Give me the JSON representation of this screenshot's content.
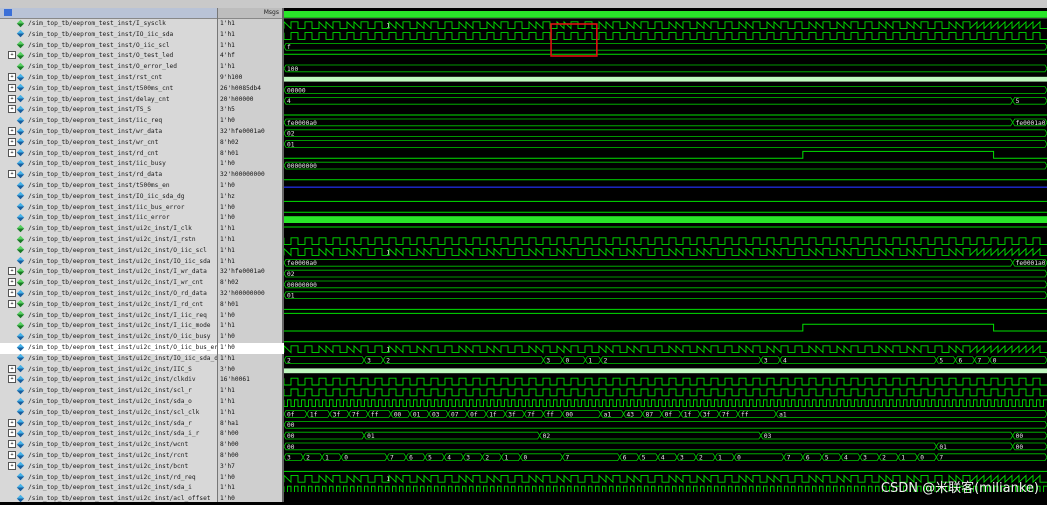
{
  "header": {
    "msgs_label": "Msgs"
  },
  "watermark": "CSDN @米联客(milianke)",
  "signals": [
    {
      "name": "/sim_top_tb/eeprom_test_inst/I_sysclk",
      "value": "1'h1",
      "exp": false,
      "in": true,
      "kind": "clk"
    },
    {
      "name": "/sim_top_tb/eeprom_test_inst/IO_iic_sda",
      "value": "1'h1",
      "exp": false,
      "in": false,
      "kind": "sda",
      "labels": [
        {
          "t": 0.13,
          "text": "1"
        }
      ]
    },
    {
      "name": "/sim_top_tb/eeprom_test_inst/O_iic_scl",
      "value": "1'h1",
      "exp": false,
      "in": true,
      "kind": "scl"
    },
    {
      "name": "/sim_top_tb/eeprom_test_inst/O_test_led",
      "value": "4'hf",
      "exp": true,
      "in": true,
      "kind": "bus",
      "labels": [
        {
          "t": 0.0,
          "text": "f"
        }
      ]
    },
    {
      "name": "/sim_top_tb/eeprom_test_inst/O_error_led",
      "value": "1'h1",
      "exp": false,
      "in": true,
      "kind": "high"
    },
    {
      "name": "/sim_top_tb/eeprom_test_inst/rst_cnt",
      "value": "9'h100",
      "exp": true,
      "in": false,
      "kind": "bus",
      "labels": [
        {
          "t": 0.0,
          "text": "100"
        }
      ]
    },
    {
      "name": "/sim_top_tb/eeprom_test_inst/t500ms_cnt",
      "value": "26'h0085db4",
      "exp": true,
      "in": false,
      "kind": "busdense"
    },
    {
      "name": "/sim_top_tb/eeprom_test_inst/delay_cnt",
      "value": "20'h00000",
      "exp": true,
      "in": false,
      "kind": "bus",
      "labels": [
        {
          "t": 0.0,
          "text": "00000"
        }
      ]
    },
    {
      "name": "/sim_top_tb/eeprom_test_inst/TS_S",
      "value": "3'h5",
      "exp": true,
      "in": false,
      "kind": "bus",
      "labels": [
        {
          "t": 0.0,
          "text": "4"
        },
        {
          "t": 0.955,
          "text": "5"
        }
      ]
    },
    {
      "name": "/sim_top_tb/eeprom_test_inst/iic_req",
      "value": "1'h0",
      "exp": false,
      "in": false,
      "kind": "low"
    },
    {
      "name": "/sim_top_tb/eeprom_test_inst/wr_data",
      "value": "32'hfe0001a0",
      "exp": true,
      "in": false,
      "kind": "bus",
      "labels": [
        {
          "t": 0.0,
          "text": "fe0000a0"
        },
        {
          "t": 0.955,
          "text": "fe0001a0"
        }
      ]
    },
    {
      "name": "/sim_top_tb/eeprom_test_inst/wr_cnt",
      "value": "8'h02",
      "exp": true,
      "in": false,
      "kind": "bus",
      "labels": [
        {
          "t": 0.0,
          "text": "02"
        }
      ]
    },
    {
      "name": "/sim_top_tb/eeprom_test_inst/rd_cnt",
      "value": "8'h01",
      "exp": true,
      "in": false,
      "kind": "bus",
      "labels": [
        {
          "t": 0.0,
          "text": "01"
        }
      ]
    },
    {
      "name": "/sim_top_tb/eeprom_test_inst/iic_busy",
      "value": "1'h0",
      "exp": false,
      "in": false,
      "kind": "busyend"
    },
    {
      "name": "/sim_top_tb/eeprom_test_inst/rd_data",
      "value": "32'h00000000",
      "exp": true,
      "in": false,
      "kind": "bus",
      "labels": [
        {
          "t": 0.0,
          "text": "00000000"
        }
      ]
    },
    {
      "name": "/sim_top_tb/eeprom_test_inst/t500ms_en",
      "value": "1'h0",
      "exp": false,
      "in": false,
      "kind": "low"
    },
    {
      "name": "/sim_top_tb/eeprom_test_inst/IO_iic_sda_dg",
      "value": "1'hz",
      "exp": false,
      "in": false,
      "kind": "hiz"
    },
    {
      "name": "/sim_top_tb/eeprom_test_inst/iic_bus_error",
      "value": "1'h0",
      "exp": false,
      "in": false,
      "kind": "low"
    },
    {
      "name": "/sim_top_tb/eeprom_test_inst/iic_error",
      "value": "1'h0",
      "exp": false,
      "in": false,
      "kind": "low"
    },
    {
      "name": "/sim_top_tb/eeprom_test_inst/ui2c_inst/I_clk",
      "value": "1'h1",
      "exp": false,
      "in": true,
      "kind": "clk"
    },
    {
      "name": "/sim_top_tb/eeprom_test_inst/ui2c_inst/I_rstn",
      "value": "1'h1",
      "exp": false,
      "in": true,
      "kind": "high"
    },
    {
      "name": "/sim_top_tb/eeprom_test_inst/ui2c_inst/O_iic_scl",
      "value": "1'h1",
      "exp": false,
      "in": true,
      "kind": "scl"
    },
    {
      "name": "/sim_top_tb/eeprom_test_inst/ui2c_inst/IO_iic_sda",
      "value": "1'h1",
      "exp": false,
      "in": false,
      "kind": "sda",
      "labels": [
        {
          "t": 0.13,
          "text": "1"
        }
      ]
    },
    {
      "name": "/sim_top_tb/eeprom_test_inst/ui2c_inst/I_wr_data",
      "value": "32'hfe0001a0",
      "exp": true,
      "in": true,
      "kind": "bus",
      "labels": [
        {
          "t": 0.0,
          "text": "fe0000a0"
        },
        {
          "t": 0.955,
          "text": "fe0001a0"
        }
      ]
    },
    {
      "name": "/sim_top_tb/eeprom_test_inst/ui2c_inst/I_wr_cnt",
      "value": "8'h02",
      "exp": true,
      "in": true,
      "kind": "bus",
      "labels": [
        {
          "t": 0.0,
          "text": "02"
        }
      ]
    },
    {
      "name": "/sim_top_tb/eeprom_test_inst/ui2c_inst/O_rd_data",
      "value": "32'h00000000",
      "exp": true,
      "in": false,
      "kind": "bus",
      "labels": [
        {
          "t": 0.0,
          "text": "00000000"
        }
      ]
    },
    {
      "name": "/sim_top_tb/eeprom_test_inst/ui2c_inst/I_rd_cnt",
      "value": "8'h01",
      "exp": true,
      "in": true,
      "kind": "bus",
      "labels": [
        {
          "t": 0.0,
          "text": "01"
        }
      ]
    },
    {
      "name": "/sim_top_tb/eeprom_test_inst/ui2c_inst/I_iic_req",
      "value": "1'h0",
      "exp": false,
      "in": true,
      "kind": "low"
    },
    {
      "name": "/sim_top_tb/eeprom_test_inst/ui2c_inst/I_iic_mode",
      "value": "1'h1",
      "exp": false,
      "in": true,
      "kind": "high"
    },
    {
      "name": "/sim_top_tb/eeprom_test_inst/ui2c_inst/O_iic_busy",
      "value": "1'h0",
      "exp": false,
      "in": false,
      "kind": "busyend"
    },
    {
      "name": "/sim_top_tb/eeprom_test_inst/ui2c_inst/O_iic_bus_error",
      "value": "1'h0",
      "exp": false,
      "in": false,
      "kind": "low",
      "selected": true
    },
    {
      "name": "/sim_top_tb/eeprom_test_inst/ui2c_inst/IO_iic_sda_dg",
      "value": "1'h1",
      "exp": false,
      "in": false,
      "kind": "sdadg",
      "labels": [
        {
          "t": 0.13,
          "text": "1"
        }
      ]
    },
    {
      "name": "/sim_top_tb/eeprom_test_inst/ui2c_inst/IIC_S",
      "value": "3'h0",
      "exp": true,
      "in": false,
      "kind": "bus",
      "labels": [
        {
          "t": 0.0,
          "text": "2"
        },
        {
          "t": 0.105,
          "text": "3"
        },
        {
          "t": 0.13,
          "text": "2"
        },
        {
          "t": 0.34,
          "text": "3"
        },
        {
          "t": 0.365,
          "text": "0"
        },
        {
          "t": 0.395,
          "text": "1"
        },
        {
          "t": 0.415,
          "text": "2"
        },
        {
          "t": 0.625,
          "text": "3"
        },
        {
          "t": 0.65,
          "text": "4"
        },
        {
          "t": 0.855,
          "text": "5"
        },
        {
          "t": 0.88,
          "text": "6"
        },
        {
          "t": 0.905,
          "text": "7"
        },
        {
          "t": 0.925,
          "text": "0"
        }
      ]
    },
    {
      "name": "/sim_top_tb/eeprom_test_inst/ui2c_inst/clkdiv",
      "value": "16'h0061",
      "exp": true,
      "in": false,
      "kind": "busdense"
    },
    {
      "name": "/sim_top_tb/eeprom_test_inst/ui2c_inst/scl_r",
      "value": "1'h1",
      "exp": false,
      "in": false,
      "kind": "scl"
    },
    {
      "name": "/sim_top_tb/eeprom_test_inst/ui2c_inst/sda_o",
      "value": "1'h1",
      "exp": false,
      "in": false,
      "kind": "scl"
    },
    {
      "name": "/sim_top_tb/eeprom_test_inst/ui2c_inst/scl_clk",
      "value": "1'h1",
      "exp": false,
      "in": false,
      "kind": "clkfast"
    },
    {
      "name": "/sim_top_tb/eeprom_test_inst/ui2c_inst/sda_r",
      "value": "8'ha1",
      "exp": true,
      "in": false,
      "kind": "bus",
      "labels": [
        {
          "t": 0.0,
          "text": "0f"
        },
        {
          "t": 0.03,
          "text": "1f"
        },
        {
          "t": 0.06,
          "text": "3f"
        },
        {
          "t": 0.085,
          "text": "7f"
        },
        {
          "t": 0.11,
          "text": "ff"
        },
        {
          "t": 0.14,
          "text": "00"
        },
        {
          "t": 0.165,
          "text": "01"
        },
        {
          "t": 0.19,
          "text": "03"
        },
        {
          "t": 0.215,
          "text": "07"
        },
        {
          "t": 0.24,
          "text": "0f"
        },
        {
          "t": 0.265,
          "text": "1f"
        },
        {
          "t": 0.29,
          "text": "3f"
        },
        {
          "t": 0.315,
          "text": "7f"
        },
        {
          "t": 0.34,
          "text": "ff"
        },
        {
          "t": 0.365,
          "text": "00"
        },
        {
          "t": 0.415,
          "text": "a1"
        },
        {
          "t": 0.445,
          "text": "43"
        },
        {
          "t": 0.47,
          "text": "87"
        },
        {
          "t": 0.495,
          "text": "0f"
        },
        {
          "t": 0.52,
          "text": "1f"
        },
        {
          "t": 0.545,
          "text": "3f"
        },
        {
          "t": 0.57,
          "text": "7f"
        },
        {
          "t": 0.595,
          "text": "ff"
        },
        {
          "t": 0.645,
          "text": "a1"
        }
      ]
    },
    {
      "name": "/sim_top_tb/eeprom_test_inst/ui2c_inst/sda_i_r",
      "value": "8'h00",
      "exp": true,
      "in": false,
      "kind": "bus",
      "labels": [
        {
          "t": 0.0,
          "text": "00"
        }
      ]
    },
    {
      "name": "/sim_top_tb/eeprom_test_inst/ui2c_inst/wcnt",
      "value": "8'h00",
      "exp": true,
      "in": false,
      "kind": "bus",
      "labels": [
        {
          "t": 0.0,
          "text": "00"
        },
        {
          "t": 0.105,
          "text": "01"
        },
        {
          "t": 0.335,
          "text": "02"
        },
        {
          "t": 0.625,
          "text": "03"
        },
        {
          "t": 0.955,
          "text": "00"
        }
      ]
    },
    {
      "name": "/sim_top_tb/eeprom_test_inst/ui2c_inst/rcnt",
      "value": "8'h00",
      "exp": true,
      "in": false,
      "kind": "bus",
      "labels": [
        {
          "t": 0.0,
          "text": "00"
        },
        {
          "t": 0.855,
          "text": "01"
        },
        {
          "t": 0.955,
          "text": "00"
        }
      ]
    },
    {
      "name": "/sim_top_tb/eeprom_test_inst/ui2c_inst/bcnt",
      "value": "3'h7",
      "exp": true,
      "in": false,
      "kind": "bus",
      "labels": [
        {
          "t": 0.0,
          "text": "3"
        },
        {
          "t": 0.025,
          "text": "2"
        },
        {
          "t": 0.05,
          "text": "1"
        },
        {
          "t": 0.075,
          "text": "0"
        },
        {
          "t": 0.135,
          "text": "7"
        },
        {
          "t": 0.16,
          "text": "6"
        },
        {
          "t": 0.185,
          "text": "5"
        },
        {
          "t": 0.21,
          "text": "4"
        },
        {
          "t": 0.235,
          "text": "3"
        },
        {
          "t": 0.26,
          "text": "2"
        },
        {
          "t": 0.285,
          "text": "1"
        },
        {
          "t": 0.31,
          "text": "0"
        },
        {
          "t": 0.365,
          "text": "7"
        },
        {
          "t": 0.44,
          "text": "6"
        },
        {
          "t": 0.465,
          "text": "5"
        },
        {
          "t": 0.49,
          "text": "4"
        },
        {
          "t": 0.515,
          "text": "3"
        },
        {
          "t": 0.54,
          "text": "2"
        },
        {
          "t": 0.565,
          "text": "1"
        },
        {
          "t": 0.59,
          "text": "0"
        },
        {
          "t": 0.655,
          "text": "7"
        },
        {
          "t": 0.68,
          "text": "6"
        },
        {
          "t": 0.705,
          "text": "5"
        },
        {
          "t": 0.73,
          "text": "4"
        },
        {
          "t": 0.755,
          "text": "3"
        },
        {
          "t": 0.78,
          "text": "2"
        },
        {
          "t": 0.805,
          "text": "1"
        },
        {
          "t": 0.83,
          "text": "0"
        },
        {
          "t": 0.855,
          "text": "7"
        }
      ]
    },
    {
      "name": "/sim_top_tb/eeprom_test_inst/ui2c_inst/rd_req",
      "value": "1'h0",
      "exp": false,
      "in": false,
      "kind": "low"
    },
    {
      "name": "/sim_top_tb/eeprom_test_inst/ui2c_inst/sda_i",
      "value": "1'h1",
      "exp": false,
      "in": false,
      "kind": "sda",
      "labels": [
        {
          "t": 0.13,
          "text": "1"
        }
      ]
    },
    {
      "name": "/sim_top_tb/eeprom_test_inst/ui2c_inst/acl_offset",
      "value": "1'h0",
      "exp": false,
      "in": false,
      "kind": "clkfast"
    }
  ],
  "colors": {
    "wave": "#00e000",
    "bus": "#00c800",
    "hiz": "#1e2bd6",
    "highlight": "#e01010",
    "clkfill": "#29e629",
    "dense": "#bff7bf"
  },
  "highlight_box_time": [
    0.35,
    0.41
  ]
}
